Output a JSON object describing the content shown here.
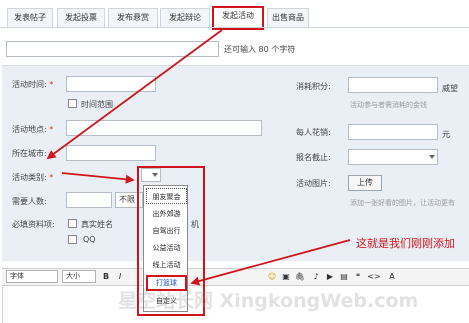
{
  "tabs": [
    {
      "label": "发表帖子"
    },
    {
      "label": "发起投票"
    },
    {
      "label": "发布悬赏"
    },
    {
      "label": "发起辩论"
    },
    {
      "label": "发起活动"
    },
    {
      "label": "出售商品"
    }
  ],
  "title": {
    "hint": "还可输入 80 个字符"
  },
  "form": {
    "time_label": "活动时间:",
    "time_range_label": "时间范围",
    "place_label": "活动地点:",
    "city_label": "所在城市:",
    "category_label": "活动类别:",
    "people_label": "需要人数:",
    "unlimited_label": "不限",
    "required_label": "必填资料项:",
    "real_name_label": "真实姓名",
    "qq_label": "QQ",
    "phone_fragment": "机",
    "credit_label": "消耗积分:",
    "credit_unit": "威望",
    "credit_note": "活动参与者需消耗的金钱",
    "cost_label": "每人花销:",
    "cost_unit": "元",
    "deadline_label": "报名截止:",
    "image_label": "活动图片:",
    "upload_label": "上传",
    "image_note": "添加一张好看的图片，让活动更有"
  },
  "dropdown": {
    "items": [
      "朋友聚会",
      "出外郊游",
      "自驾出行",
      "公益活动",
      "线上活动",
      "打篮球",
      "自定义"
    ],
    "highlighted": "打篮球"
  },
  "toolbar": {
    "font_label": "字体",
    "size_label": "大小",
    "bold": "B",
    "italic": "I",
    "icons": [
      "☺",
      "▣",
      "🖇",
      "♪",
      "▶",
      "▤",
      "❝",
      "<>",
      "A"
    ]
  },
  "annotation": "这就是我们刚刚添加",
  "watermark": "星空站长网 XingkongWeb.com",
  "colors": {
    "highlight": "#d0141b",
    "panel": "#e9eff5",
    "link": "#1a4fd0"
  }
}
